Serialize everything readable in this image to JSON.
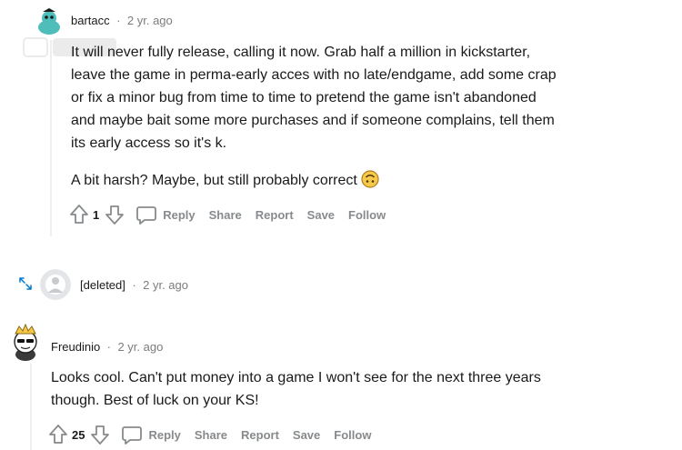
{
  "comment1": {
    "username": "bartacc",
    "separator": "·",
    "time": "2 yr. ago",
    "paragraphs": [
      "It will never fully release, calling it now. Grab half a million in kickstarter,",
      "leave the game in perma-early acces with no late/endgame, add some crap",
      "or fix a minor bug from time to time to pretend the game isn't abandoned",
      "and maybe bait some more purchases and if someone complains, tell them",
      "its early access so it's k."
    ],
    "paragraph2": "A bit harsh? Maybe, but still probably correct",
    "emoji_icon": "upside-down-face-icon",
    "votes": "1",
    "actions": {
      "reply": "Reply",
      "share": "Share",
      "report": "Report",
      "save": "Save",
      "follow": "Follow"
    }
  },
  "comment2": {
    "username": "[deleted]",
    "separator": "·",
    "time": "2 yr. ago",
    "expand_icon": "expand-arrows-icon"
  },
  "comment3": {
    "username": "Freudinio",
    "separator": "·",
    "time": "2 yr. ago",
    "lines": [
      "Looks cool. Can't put money into a game I won't see for the next three years",
      "though. Best of luck on your KS!"
    ],
    "votes": "25",
    "actions": {
      "reply": "Reply",
      "share": "Share",
      "report": "Report",
      "save": "Save",
      "follow": "Follow"
    }
  },
  "colors": {
    "text": "#1a1a1b",
    "meta": "#7c7c7c",
    "action": "#878a8c",
    "thread": "#edeff1"
  }
}
